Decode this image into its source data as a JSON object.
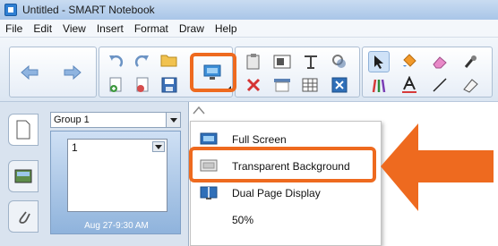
{
  "window": {
    "title": "Untitled - SMART Notebook"
  },
  "menubar": {
    "items": [
      "File",
      "Edit",
      "View",
      "Insert",
      "Format",
      "Draw",
      "Help"
    ]
  },
  "left_panel": {
    "group_select_value": "Group 1",
    "page_number": "1",
    "page_caption": "Aug 27-9:30 AM"
  },
  "view_menu": {
    "items": [
      "Full Screen",
      "Transparent Background",
      "Dual Page Display",
      "50%"
    ],
    "highlighted_index": 1
  },
  "colors": {
    "highlight": "#ee6a1f",
    "titlebar": "#b7cfeb",
    "toolbar": "#e7eef7"
  },
  "icons": {
    "toolbar": [
      "back-arrow-icon",
      "forward-arrow-icon",
      "undo-icon",
      "redo-icon",
      "open-folder-icon",
      "add-page-icon",
      "delete-page-icon",
      "save-icon",
      "display-screen-icon",
      "paste-icon",
      "delete-x-icon",
      "screen-shade-icon",
      "table-icon",
      "insert-image-icon",
      "text-icon",
      "record-icon",
      "fit-icon",
      "select-arrow-icon",
      "fill-icon",
      "eraser-icon",
      "magic-pen-icon",
      "creative-pens-icon",
      "text-tool-icon",
      "line-icon",
      "shape-icon"
    ]
  }
}
